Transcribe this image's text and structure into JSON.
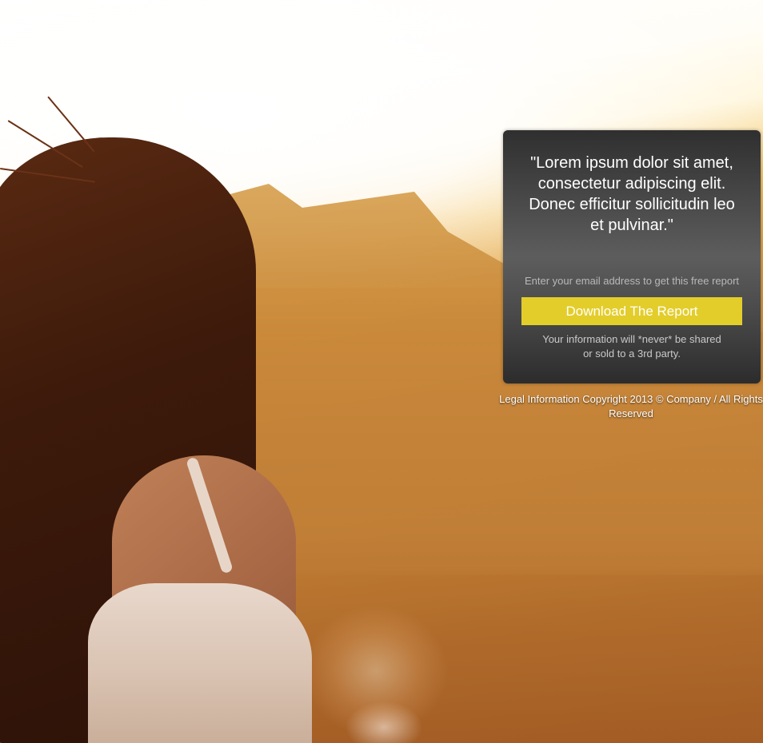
{
  "optin": {
    "quote": "\"Lorem ipsum dolor sit amet, consectetur adipiscing elit. Donec efficitur sollicitudin leo et pulvinar.\"",
    "prompt": "Enter your email address to get this free report",
    "cta_label": "Download The Report",
    "privacy_line1": "Your information will *never* be shared",
    "privacy_line2": "or sold to a 3rd party."
  },
  "footer": {
    "legal_link": "Legal Information",
    "copyright": "Copyright 2013 © Company / All Rights Reserved"
  },
  "colors": {
    "cta_background": "#e3cd2a",
    "box_background": "#4b4b4b"
  }
}
